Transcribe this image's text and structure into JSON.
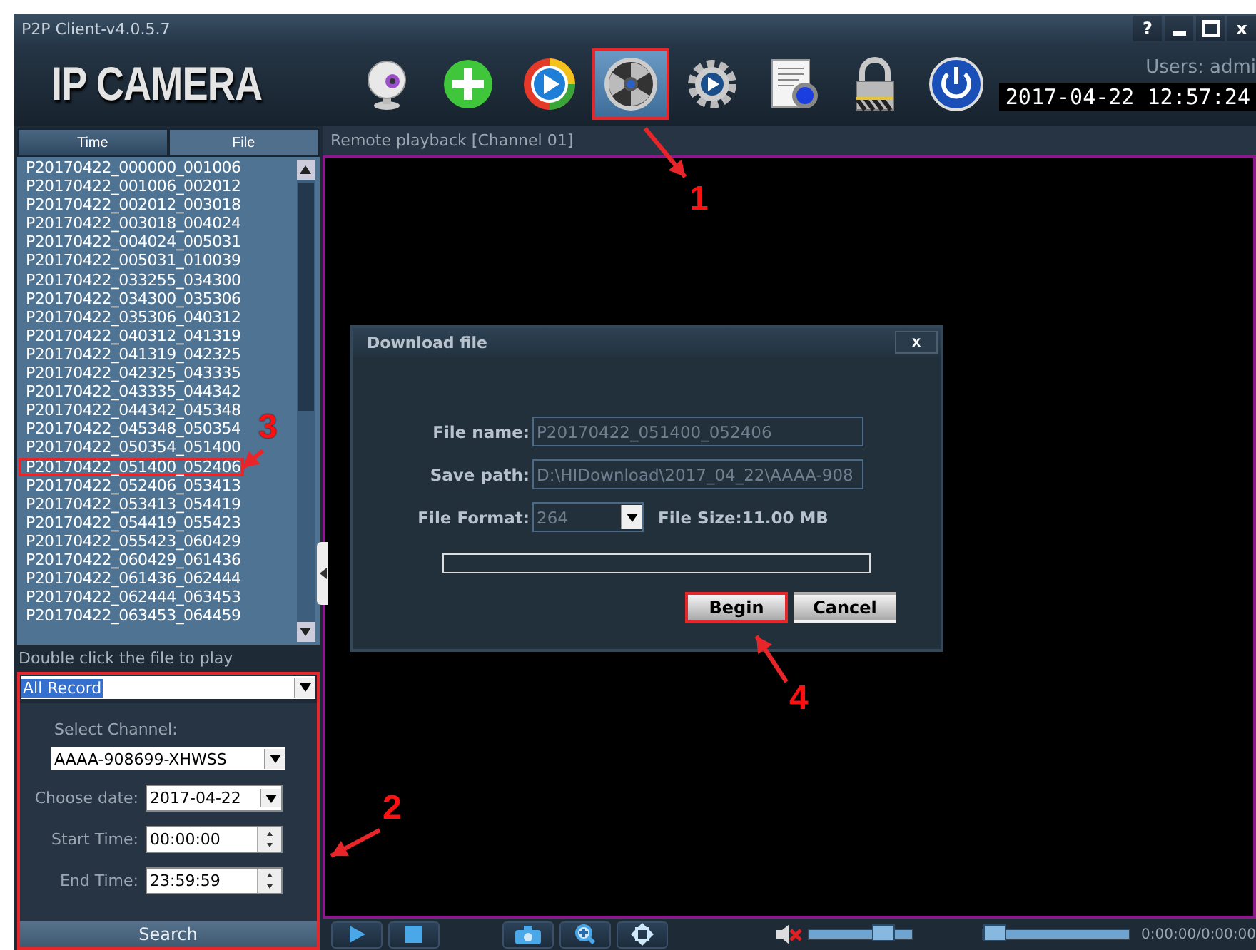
{
  "window": {
    "title": "P2P Client-v4.0.5.7",
    "controls": [
      {
        "kind": "help",
        "label": "?"
      },
      {
        "kind": "minimize"
      },
      {
        "kind": "maximize"
      },
      {
        "kind": "close",
        "label": "x"
      }
    ]
  },
  "logo": "IP CAMERA",
  "toolbar": [
    {
      "kind": "webcam",
      "selected": false,
      "highlighted": false
    },
    {
      "kind": "add",
      "selected": false,
      "highlighted": false
    },
    {
      "kind": "play",
      "selected": false,
      "highlighted": false
    },
    {
      "kind": "reel",
      "selected": true,
      "highlighted": true
    },
    {
      "kind": "settings",
      "selected": false,
      "highlighted": false
    },
    {
      "kind": "document",
      "selected": false,
      "highlighted": false
    },
    {
      "kind": "lock",
      "selected": false,
      "highlighted": false
    },
    {
      "kind": "power",
      "selected": false,
      "highlighted": false
    }
  ],
  "user": "Users: admi",
  "clock": "2017-04-22 12:57:24",
  "sidebar": {
    "tabs": [
      {
        "label": "Time",
        "selected": false
      },
      {
        "label": "File",
        "selected": true
      }
    ],
    "files": [
      {
        "name": "P20170422_000000_001006",
        "highlighted": false
      },
      {
        "name": "P20170422_001006_002012",
        "highlighted": false
      },
      {
        "name": "P20170422_002012_003018",
        "highlighted": false
      },
      {
        "name": "P20170422_003018_004024",
        "highlighted": false
      },
      {
        "name": "P20170422_004024_005031",
        "highlighted": false
      },
      {
        "name": "P20170422_005031_010039",
        "highlighted": false
      },
      {
        "name": "P20170422_033255_034300",
        "highlighted": false
      },
      {
        "name": "P20170422_034300_035306",
        "highlighted": false
      },
      {
        "name": "P20170422_035306_040312",
        "highlighted": false
      },
      {
        "name": "P20170422_040312_041319",
        "highlighted": false
      },
      {
        "name": "P20170422_041319_042325",
        "highlighted": false
      },
      {
        "name": "P20170422_042325_043335",
        "highlighted": false
      },
      {
        "name": "P20170422_043335_044342",
        "highlighted": false
      },
      {
        "name": "P20170422_044342_045348",
        "highlighted": false
      },
      {
        "name": "P20170422_045348_050354",
        "highlighted": false
      },
      {
        "name": "P20170422_050354_051400",
        "highlighted": false
      },
      {
        "name": "P20170422_051400_052406",
        "highlighted": true
      },
      {
        "name": "P20170422_052406_053413",
        "highlighted": false
      },
      {
        "name": "P20170422_053413_054419",
        "highlighted": false
      },
      {
        "name": "P20170422_054419_055423",
        "highlighted": false
      },
      {
        "name": "P20170422_055423_060429",
        "highlighted": false
      },
      {
        "name": "P20170422_060429_061436",
        "highlighted": false
      },
      {
        "name": "P20170422_061436_062444",
        "highlighted": false
      },
      {
        "name": "P20170422_062444_063453",
        "highlighted": false
      },
      {
        "name": "P20170422_063453_064459",
        "highlighted": false
      }
    ],
    "hint": "Double click the file to play",
    "filter": {
      "highlighted": true,
      "record_type": "All Record",
      "channel_label": "Select Channel:",
      "channel": "AAAA-908699-XHWSS",
      "date_label": "Choose date:",
      "date": "2017-04-22",
      "start_label": "Start Time:",
      "start": "00:00:00",
      "end_label": "End Time:",
      "end": "23:59:59",
      "search": "Search"
    }
  },
  "playback": {
    "title": "Remote playback [Channel 01]",
    "controls": [
      {
        "kind": "play"
      },
      {
        "kind": "stop"
      },
      {
        "kind": "snapshot"
      },
      {
        "kind": "zoom"
      },
      {
        "kind": "fullscreen"
      }
    ],
    "muted": true,
    "volume": {
      "level": 0.8
    },
    "progress": {
      "level": 0
    },
    "time": "0:00:00/0:00:00"
  },
  "dialog": {
    "title": "Download file",
    "close": "x",
    "file_name_label": "File name:",
    "file_name": "P20170422_051400_052406",
    "save_path_label": "Save path:",
    "save_path": "D:\\HIDownload\\2017_04_22\\AAAA-908",
    "format_label": "File Format:",
    "format": "264",
    "size": "File Size:11.00 MB",
    "progress": {
      "level": 0
    },
    "buttons": [
      {
        "label": "Begin",
        "highlighted": true
      },
      {
        "label": "Cancel",
        "highlighted": false
      }
    ]
  },
  "annotations": [
    {
      "label": "1"
    },
    {
      "label": "2"
    },
    {
      "label": "3"
    },
    {
      "label": "4"
    }
  ]
}
